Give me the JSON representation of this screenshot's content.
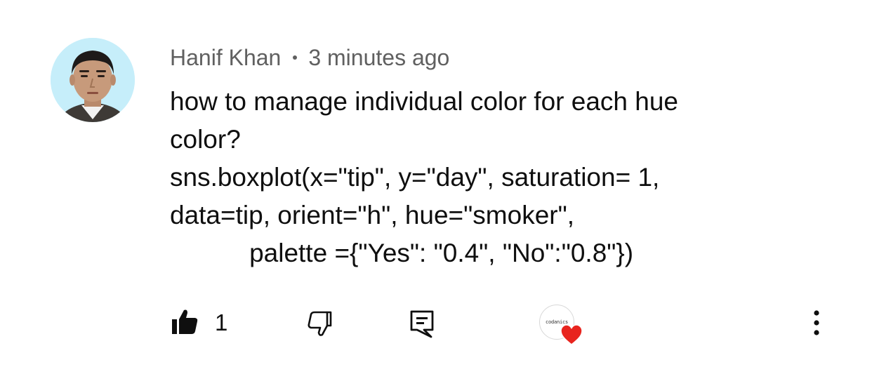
{
  "comment": {
    "author": "Hanif Khan",
    "separator": "•",
    "timestamp": "3 minutes ago",
    "lines": [
      "how to manage individual color for each hue",
      "color?",
      "sns.boxplot(x=\"tip\", y=\"day\", saturation= 1,",
      "data=tip, orient=\"h\", hue=\"smoker\",",
      "           palette ={\"Yes\": \"0.4\", \"No\":\"0.8\"})"
    ]
  },
  "actions": {
    "like_icon": "thumbs-up-filled-icon",
    "like_count": "1",
    "dislike_icon": "thumbs-down-outline-icon",
    "reply_icon": "reply-comment-icon",
    "creator_avatar_text": "codanics",
    "creator_heart_icon": "heart-icon",
    "heart_color": "#e8241e",
    "more_icon": "more-vertical-icon"
  }
}
